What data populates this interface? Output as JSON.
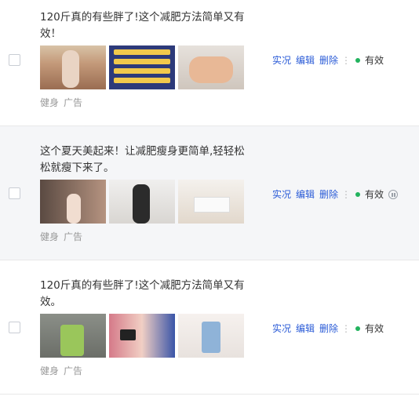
{
  "rows": [
    {
      "title": "120斤真的有些胖了!这个减肥方法简单又有效！",
      "tags": [
        "健身",
        "广告"
      ],
      "actions": [
        "实况",
        "编辑",
        "删除"
      ],
      "more": "⋮",
      "status": "有效",
      "highlighted": false,
      "show_pause": false
    },
    {
      "title": "这个夏天美起来！让减肥瘦身更简单,轻轻松松就瘦下来了。",
      "tags": [
        "健身",
        "广告"
      ],
      "actions": [
        "实况",
        "编辑",
        "删除"
      ],
      "more": "⋮",
      "status": "有效",
      "highlighted": true,
      "show_pause": true
    },
    {
      "title": "120斤真的有些胖了!这个减肥方法简单又有效。",
      "tags": [
        "健身",
        "广告"
      ],
      "actions": [
        "实况",
        "编辑",
        "删除"
      ],
      "more": "⋮",
      "status": "有效",
      "highlighted": false,
      "show_pause": false
    }
  ],
  "colors": {
    "link": "#2a5bd7",
    "status_dot": "#22b35e",
    "highlight_row": "#f5f6f8"
  },
  "icons": [
    "checkbox",
    "more-vertical-icon",
    "status-dot-icon",
    "pause-icon"
  ]
}
